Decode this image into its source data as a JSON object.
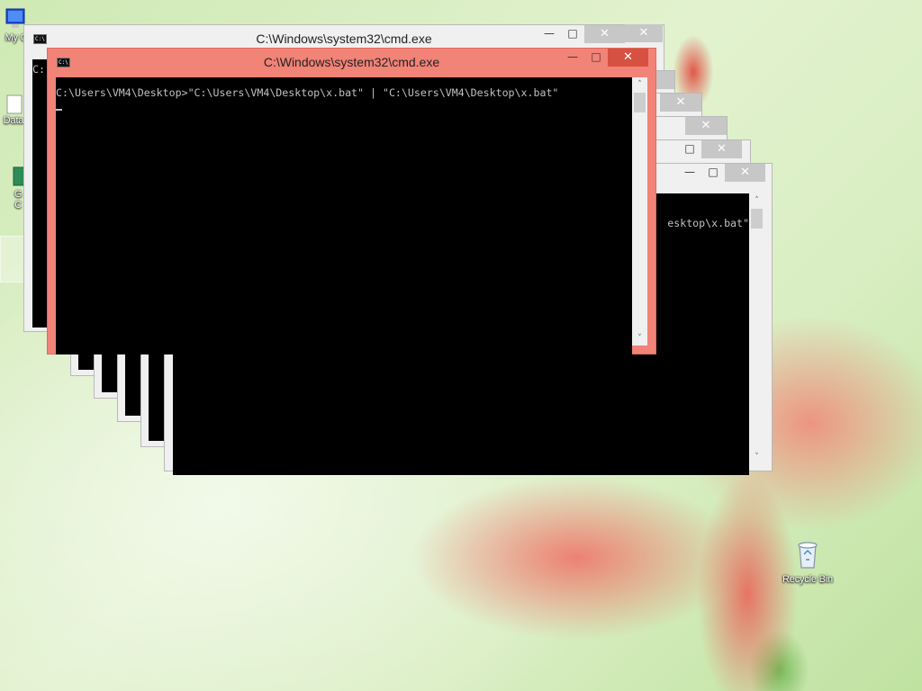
{
  "desktop": {
    "icons": [
      {
        "label": "My C",
        "icon": "computer-icon"
      },
      {
        "label": "Data",
        "icon": "document-icon"
      },
      {
        "label": "G",
        "icon": "shortcut-icon"
      },
      {
        "label": "C",
        "icon": "shortcut-icon"
      },
      {
        "label": "Recycle Bin",
        "icon": "recycle-bin-icon"
      }
    ]
  },
  "window": {
    "title": "C:\\Windows\\system32\\cmd.exe",
    "app_icon": "C:\\",
    "minimize_glyph": "—",
    "maximize_glyph": "□",
    "close_glyph": "✕"
  },
  "front_console": {
    "prompt_line": "C:\\Users\\VM4\\Desktop>\"C:\\Users\\VM4\\Desktop\\x.bat\" | \"C:\\Users\\VM4\\Desktop\\x.bat\""
  },
  "back_console": {
    "visible_line": "esktop\\x.bat\"",
    "partial_prompt": "C:"
  },
  "scroll": {
    "up": "˄",
    "down": "˅"
  },
  "colors": {
    "front_window": "#f28377",
    "inactive_window": "#f0f0f0",
    "console_bg": "#000000",
    "console_text": "#c0c0c0"
  }
}
